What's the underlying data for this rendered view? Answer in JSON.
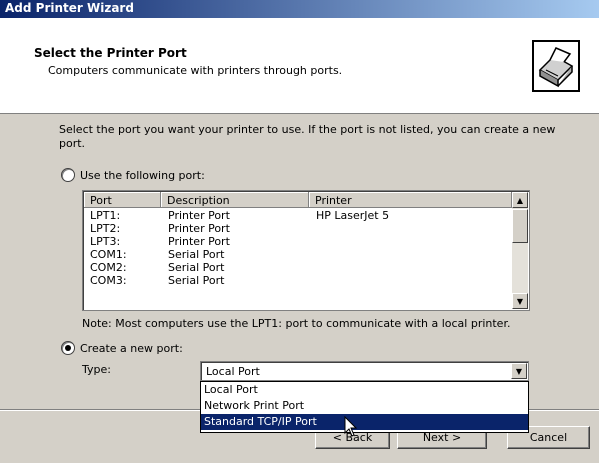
{
  "window": {
    "title": "Add Printer Wizard"
  },
  "header": {
    "title": "Select the Printer Port",
    "subtitle": "Computers communicate with printers through ports.",
    "icon": "printer-port-icon"
  },
  "intro": "Select the port you want your printer to use.  If the port is not listed, you can create a new port.",
  "use_existing": {
    "label": "Use the following port:",
    "checked": false
  },
  "port_list": {
    "columns": [
      "Port",
      "Description",
      "Printer"
    ],
    "rows": [
      {
        "port": "LPT1:",
        "description": "Printer Port",
        "printer": "HP LaserJet 5"
      },
      {
        "port": "LPT2:",
        "description": "Printer Port",
        "printer": ""
      },
      {
        "port": "LPT3:",
        "description": "Printer Port",
        "printer": ""
      },
      {
        "port": "COM1:",
        "description": "Serial Port",
        "printer": ""
      },
      {
        "port": "COM2:",
        "description": "Serial Port",
        "printer": ""
      },
      {
        "port": "COM3:",
        "description": "Serial Port",
        "printer": ""
      }
    ]
  },
  "note": "Note: Most computers use the LPT1: port to communicate with a local printer.",
  "create_new": {
    "label": "Create a new port:",
    "checked": true,
    "type_label": "Type:",
    "type_value": "Local Port",
    "options": [
      "Local Port",
      "Network Print Port",
      "Standard TCP/IP Port"
    ],
    "highlighted": "Standard TCP/IP Port"
  },
  "buttons": {
    "back": "< Back",
    "next": "Next >",
    "cancel": "Cancel"
  }
}
